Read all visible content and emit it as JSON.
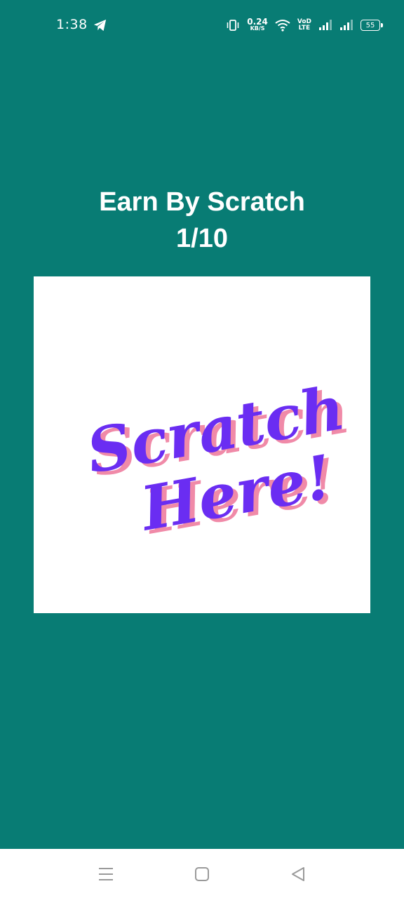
{
  "status_bar": {
    "time": "1:38",
    "net_speed_value": "0.24",
    "net_speed_unit": "KB/S",
    "volte_top": "VoD",
    "volte_bottom": "LTE",
    "battery": "55"
  },
  "page": {
    "title": "Earn By Scratch",
    "progress": "1/10"
  },
  "scratch_card": {
    "line1": "Scratch",
    "line2": "Here!",
    "colors": {
      "text": "#6a2df2",
      "shadow": "#f08aa8",
      "background": "#ffffff"
    }
  },
  "theme": {
    "background": "#087c74",
    "nav_background": "#ffffff"
  },
  "nav_bar": {
    "menu_icon": "menu-icon",
    "home_icon": "home-square-icon",
    "back_icon": "back-triangle-icon"
  }
}
